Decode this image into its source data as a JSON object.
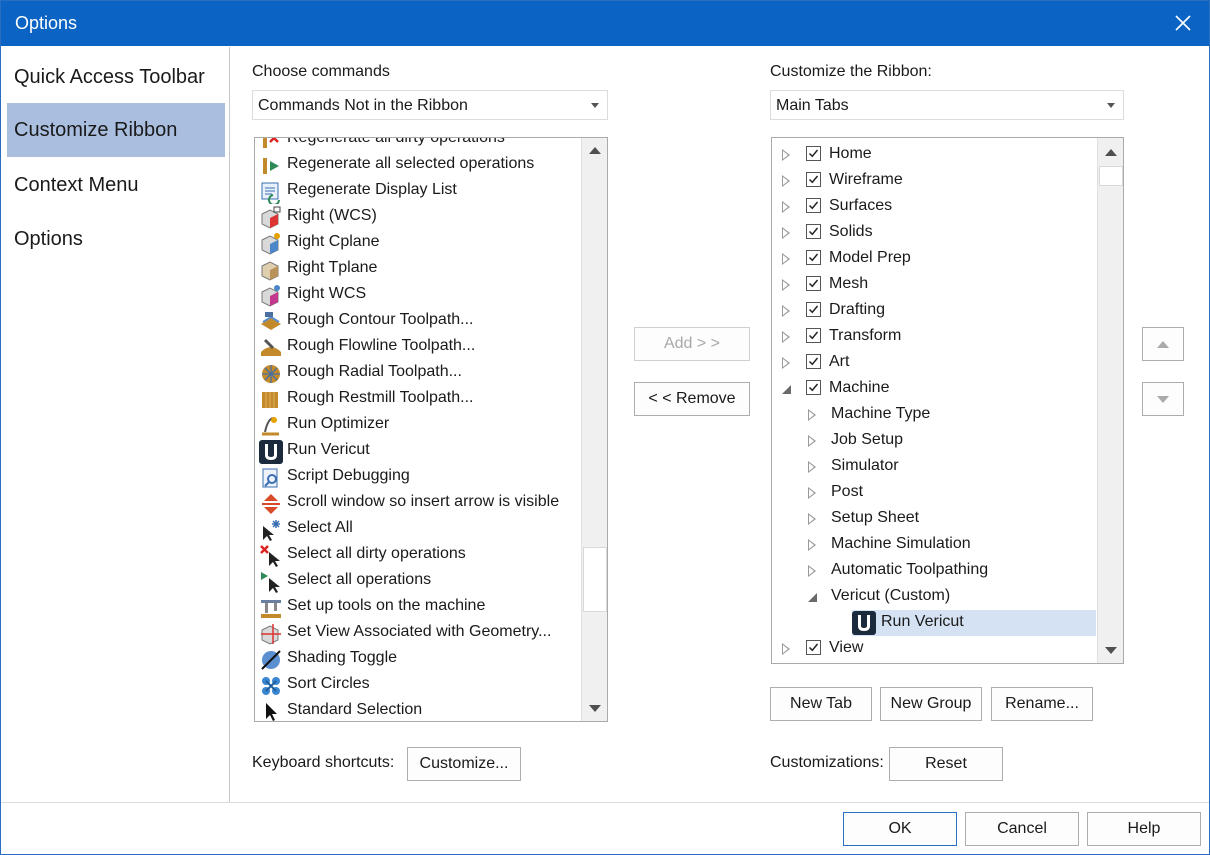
{
  "window": {
    "title": "Options"
  },
  "nav": {
    "items": [
      {
        "label": "Quick Access Toolbar",
        "selected": false
      },
      {
        "label": "Customize Ribbon",
        "selected": true
      },
      {
        "label": "Context Menu",
        "selected": false
      },
      {
        "label": "Options",
        "selected": false
      }
    ]
  },
  "left": {
    "label": "Choose commands",
    "combo_value": "Commands Not in the Ribbon",
    "commands": [
      {
        "label": "Regenerate all dirty operations",
        "icon": "regen-dirty-icon"
      },
      {
        "label": "Regenerate all selected operations",
        "icon": "regen-selected-icon"
      },
      {
        "label": "Regenerate Display List",
        "icon": "display-list-icon"
      },
      {
        "label": "Right (WCS)",
        "icon": "cube-right-wcs-icon"
      },
      {
        "label": "Right Cplane",
        "icon": "cube-cplane-icon"
      },
      {
        "label": "Right Tplane",
        "icon": "cube-tplane-icon"
      },
      {
        "label": "Right WCS",
        "icon": "cube-wcs-icon"
      },
      {
        "label": "Rough Contour Toolpath...",
        "icon": "rough-contour-icon"
      },
      {
        "label": "Rough Flowline Toolpath...",
        "icon": "rough-flowline-icon"
      },
      {
        "label": "Rough Radial Toolpath...",
        "icon": "rough-radial-icon"
      },
      {
        "label": "Rough Restmill Toolpath...",
        "icon": "rough-restmill-icon"
      },
      {
        "label": "Run Optimizer",
        "icon": "optimizer-icon"
      },
      {
        "label": "Run Vericut",
        "icon": "vericut-icon"
      },
      {
        "label": "Script Debugging",
        "icon": "script-debug-icon"
      },
      {
        "label": "Scroll window so insert arrow is visible",
        "icon": "scroll-arrow-icon"
      },
      {
        "label": "Select All",
        "icon": "select-all-icon"
      },
      {
        "label": "Select all dirty operations",
        "icon": "select-dirty-icon"
      },
      {
        "label": "Select all operations",
        "icon": "select-ops-icon"
      },
      {
        "label": "Set up tools on the machine",
        "icon": "setup-tools-icon"
      },
      {
        "label": "Set View Associated with Geometry...",
        "icon": "set-view-icon"
      },
      {
        "label": "Shading Toggle",
        "icon": "shading-icon"
      },
      {
        "label": "Sort Circles",
        "icon": "sort-circles-icon"
      },
      {
        "label": "Standard Selection",
        "icon": "cursor-icon"
      }
    ]
  },
  "middle": {
    "add_label": "Add > >",
    "remove_label": "< < Remove"
  },
  "right": {
    "label": "Customize the Ribbon:",
    "combo_value": "Main Tabs",
    "tree": [
      {
        "label": "Home",
        "level": 0,
        "expanded": false,
        "checked": true
      },
      {
        "label": "Wireframe",
        "level": 0,
        "expanded": false,
        "checked": true
      },
      {
        "label": "Surfaces",
        "level": 0,
        "expanded": false,
        "checked": true
      },
      {
        "label": "Solids",
        "level": 0,
        "expanded": false,
        "checked": true
      },
      {
        "label": "Model Prep",
        "level": 0,
        "expanded": false,
        "checked": true
      },
      {
        "label": "Mesh",
        "level": 0,
        "expanded": false,
        "checked": true
      },
      {
        "label": "Drafting",
        "level": 0,
        "expanded": false,
        "checked": true
      },
      {
        "label": "Transform",
        "level": 0,
        "expanded": false,
        "checked": true
      },
      {
        "label": "Art",
        "level": 0,
        "expanded": false,
        "checked": true
      },
      {
        "label": "Machine",
        "level": 0,
        "expanded": true,
        "checked": true
      },
      {
        "label": "Machine Type",
        "level": 1,
        "expanded": false
      },
      {
        "label": "Job Setup",
        "level": 1,
        "expanded": false
      },
      {
        "label": "Simulator",
        "level": 1,
        "expanded": false
      },
      {
        "label": "Post",
        "level": 1,
        "expanded": false
      },
      {
        "label": "Setup Sheet",
        "level": 1,
        "expanded": false
      },
      {
        "label": "Machine Simulation",
        "level": 1,
        "expanded": false
      },
      {
        "label": "Automatic Toolpathing",
        "level": 1,
        "expanded": false
      },
      {
        "label": "Vericut (Custom)",
        "level": 1,
        "expanded": true
      },
      {
        "label": "Run Vericut",
        "level": 2,
        "selected": true,
        "icon": "vericut-icon"
      },
      {
        "label": "View",
        "level": 0,
        "expanded": false,
        "checked": true
      }
    ],
    "new_tab_label": "New Tab",
    "new_group_label": "New Group",
    "rename_label": "Rename...",
    "customizations_label": "Customizations:",
    "reset_label": "Reset"
  },
  "keyboard": {
    "label": "Keyboard shortcuts:",
    "button_label": "Customize..."
  },
  "footer": {
    "ok_label": "OK",
    "cancel_label": "Cancel",
    "help_label": "Help"
  },
  "colors": {
    "titlebar": "#0b63c4",
    "selected_nav": "#aabfe0",
    "selected_row": "#d5e2f3"
  }
}
